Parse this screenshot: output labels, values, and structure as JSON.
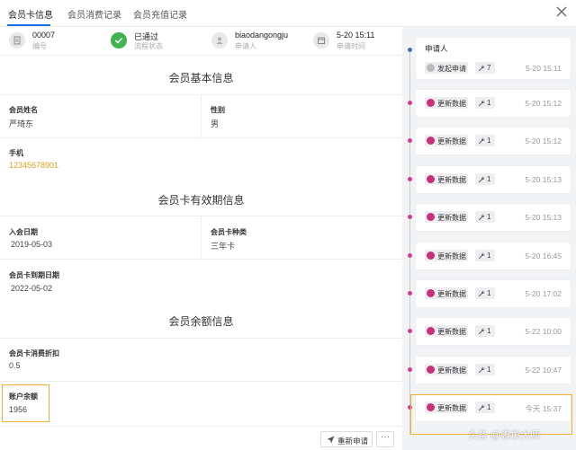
{
  "tabs": [
    {
      "label": "会员卡信息",
      "active": true
    },
    {
      "label": "会员消费记录",
      "active": false
    },
    {
      "label": "会员充值记录",
      "active": false
    }
  ],
  "stats": [
    {
      "value": "00007",
      "label": "编号",
      "icon": "document-icon"
    },
    {
      "value": "已通过",
      "label": "流程状态",
      "icon": "check-icon"
    },
    {
      "value": "biaodangongju",
      "label": "申请人",
      "icon": "user-icon"
    },
    {
      "value": "5-20 15:11",
      "label": "申请时间",
      "icon": "calendar-icon"
    }
  ],
  "sections": {
    "basic": "会员基本信息",
    "validity": "会员卡有效期信息",
    "balance": "会员余额信息"
  },
  "fields": {
    "name_label": "会员姓名",
    "name_value": "严琦东",
    "gender_label": "性别",
    "gender_value": "男",
    "phone_label": "手机",
    "phone_value": "12345678901",
    "join_label": "入会日期",
    "join_value": "2019-05-03",
    "cardtype_label": "会员卡种类",
    "cardtype_value": "三年卡",
    "expire_label": "会员卡到期日期",
    "expire_value": "2022-05-02",
    "discount_label": "会员卡消费折扣",
    "discount_value": "0.5",
    "balance_label": "账户余额",
    "balance_value": "1956"
  },
  "actions": {
    "resubmit": "重新申请",
    "more": "···"
  },
  "timeline": {
    "applicant_label": "申请人",
    "entries": [
      {
        "action": "发起申请",
        "count": "7",
        "time": "5-20 15:11"
      },
      {
        "action": "更新数据",
        "count": "1",
        "time": "5-20 15:12"
      },
      {
        "action": "更新数据",
        "count": "1",
        "time": "5-20 15:12"
      },
      {
        "action": "更新数据",
        "count": "1",
        "time": "5-20 15:13"
      },
      {
        "action": "更新数据",
        "count": "1",
        "time": "5-20 15:13"
      },
      {
        "action": "更新数据",
        "count": "1",
        "time": "5-20 16:45"
      },
      {
        "action": "更新数据",
        "count": "1",
        "time": "5-20 17:02"
      },
      {
        "action": "更新数据",
        "count": "1",
        "time": "5-22 10:00"
      },
      {
        "action": "更新数据",
        "count": "1",
        "time": "5-22 10:47"
      },
      {
        "action": "更新数据",
        "count": "1",
        "time": "今天 15:37"
      }
    ]
  },
  "watermark": "头条 @表单大师",
  "colors": {
    "accent": "#1a73e8",
    "success": "#3fb34f",
    "highlight": "#f2b130",
    "timeline_dot": "#d33d8d",
    "phone_link": "#e0a020"
  }
}
